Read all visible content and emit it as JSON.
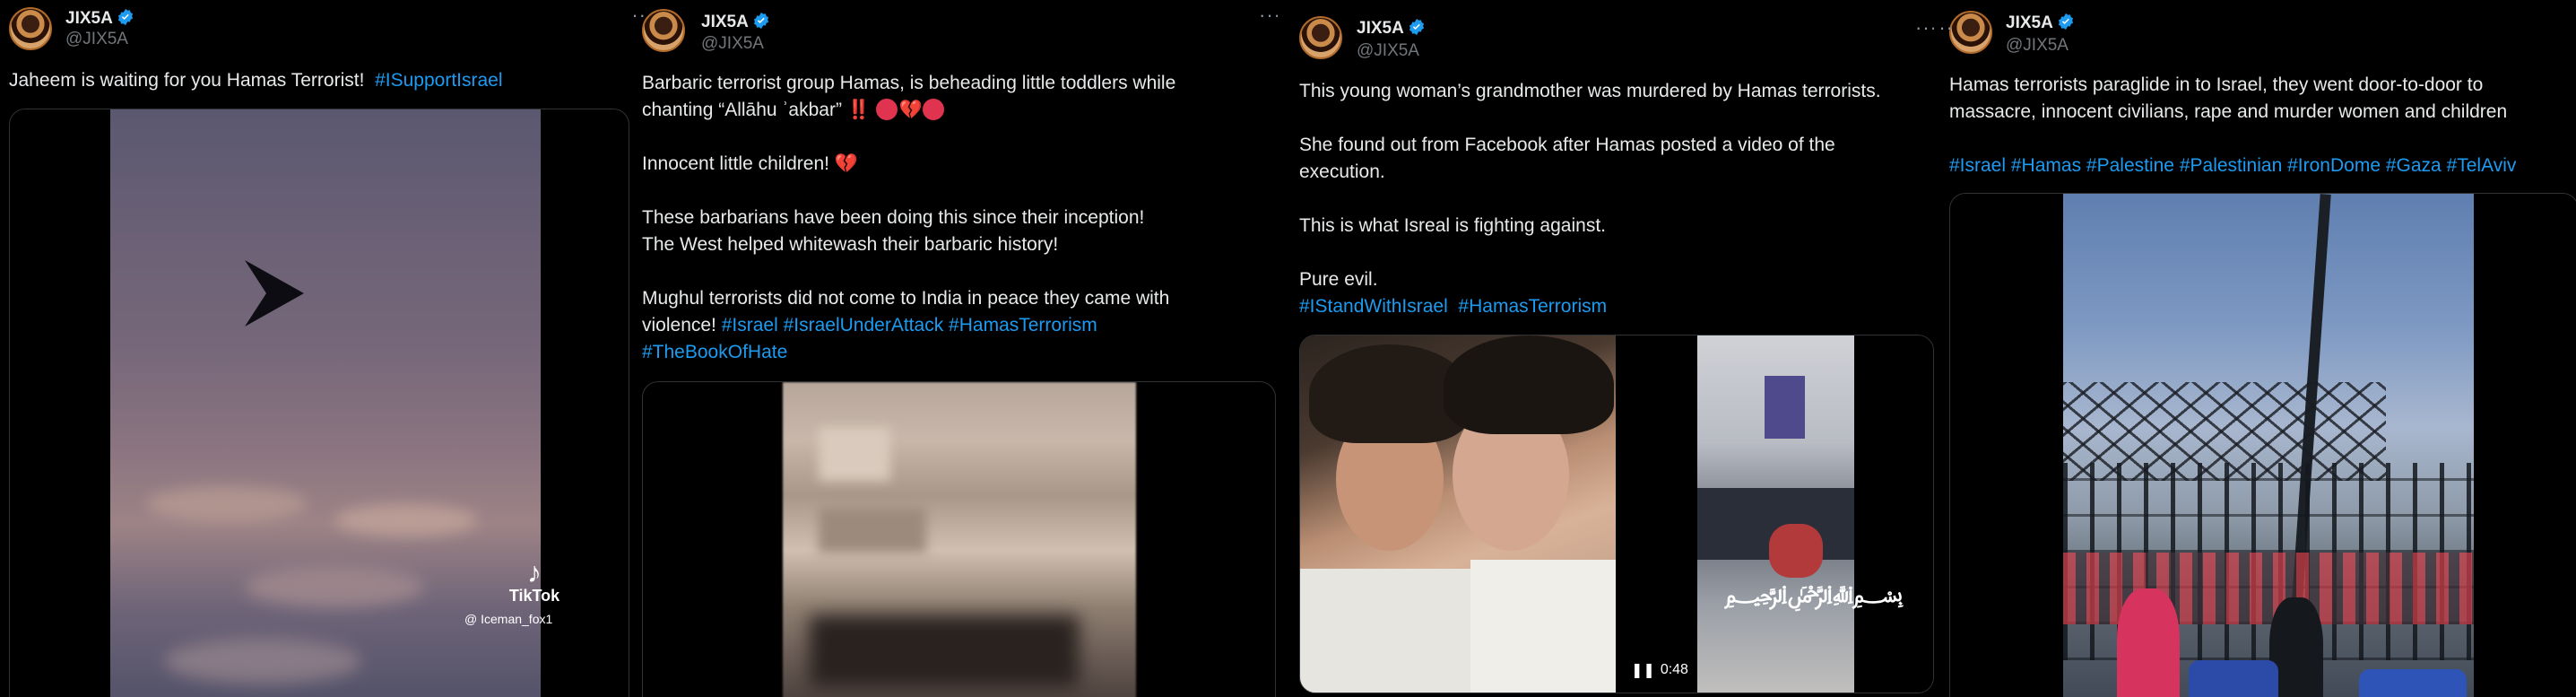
{
  "colors": {
    "accent": "#1d9bf0",
    "text": "#e7e9ea",
    "muted": "#71767b",
    "background": "#000000"
  },
  "tweets": [
    {
      "name": "JIX5A",
      "handle": "@JIX5A",
      "text": "Jaheem is waiting for you Hamas Terrorist!",
      "hashtags": [
        "#ISupportIsrael"
      ],
      "media": {
        "watermark": "TikTok",
        "watermark_user": "@ Iceman_fox1"
      }
    },
    {
      "name": "JIX5A",
      "handle": "@JIX5A",
      "more": "···",
      "lines": [
        "Barbaric terrorist group Hamas, is beheading little toddlers while",
        "chanting  “Allāhu ʾakbar” ‼️",
        "Innocent little children!",
        "These barbarians have been doing this since their inception!",
        "The West helped whitewash their barbaric history!",
        "Mughul terrorists  did not come to India in peace they came with",
        "violence!"
      ],
      "hashtags": [
        "#Israel",
        "#IsraelUnderAttack",
        "#HamasTerrorism",
        "#TheBookOfHate"
      ]
    },
    {
      "name": "JIX5A",
      "handle": "@JIX5A",
      "more": "···",
      "lines": [
        "This young woman’s grandmother was murdered by Hamas terrorists.",
        "She found out from Facebook after Hamas posted a video of the",
        "execution.",
        "This is what Isreal is fighting against.",
        "Pure evil."
      ],
      "hashtags": [
        "#IStandWithIsrael",
        "#HamasTerrorism"
      ],
      "video_time": "0:48"
    },
    {
      "name": "JIX5A",
      "handle": "@JIX5A",
      "more": "···",
      "lines": [
        "Hamas terrorists paraglide in to Israel, they went door-to-door to",
        "massacre, innocent civilians, rape and murder women and children"
      ],
      "hashtags": [
        "#Israel",
        "#Hamas",
        "#Palestine",
        "#Palestinian",
        "#IronDome",
        "#Gaza",
        "#TelAviv"
      ]
    }
  ]
}
